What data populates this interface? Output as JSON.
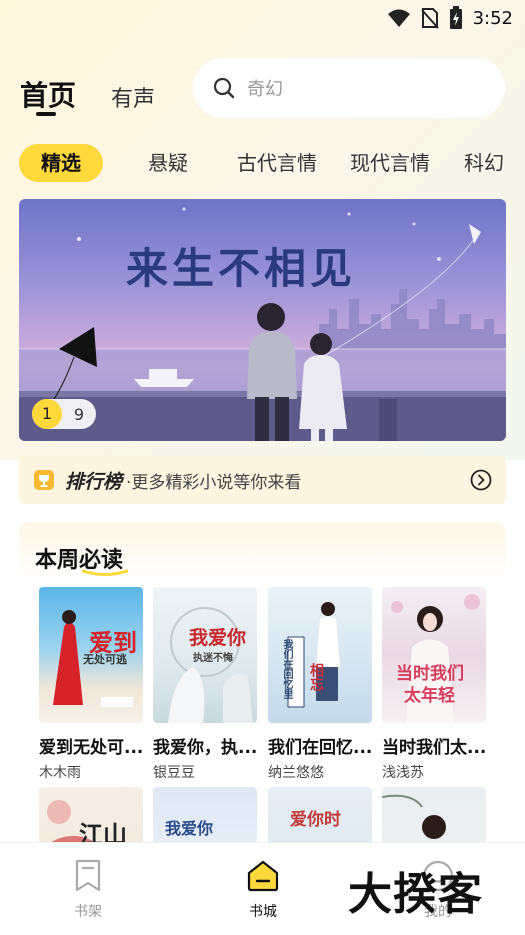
{
  "status_bar": {
    "time": "3:52"
  },
  "header": {
    "tabs": [
      {
        "label": "首页"
      },
      {
        "label": "有声"
      }
    ],
    "search": {
      "placeholder": "奇幻"
    }
  },
  "categories": [
    {
      "label": "精选"
    },
    {
      "label": "悬疑"
    },
    {
      "label": "古代言情"
    },
    {
      "label": "现代言情"
    },
    {
      "label": "科幻"
    }
  ],
  "banner": {
    "title": "来生不相见",
    "pager": {
      "current": "1",
      "total": "9"
    }
  },
  "ranking": {
    "title": "排行榜",
    "subtitle": "·更多精彩小说等你来看"
  },
  "weekly": {
    "title": "本周必读",
    "books": [
      {
        "title": "爱到无处可...",
        "author": "木木雨",
        "cover_text": "爱到",
        "cover_sub": "无处可逃"
      },
      {
        "title": "我爱你，执...",
        "author": "银豆豆",
        "cover_text": "我爱你",
        "cover_sub": "执迷不悔"
      },
      {
        "title": "我们在回忆...",
        "author": "纳兰悠悠",
        "cover_text": "相忘",
        "cover_sub": "我们在回忆里"
      },
      {
        "title": "当时我们太...",
        "author": "浅浅苏",
        "cover_text": "当时我们",
        "cover_sub": "太年轻"
      }
    ],
    "second_row": [
      {
        "cover_text": "江山"
      },
      {
        "cover_text": "我爱你"
      },
      {
        "cover_text": "爱你时"
      },
      {
        "cover_text": ""
      }
    ]
  },
  "bottom_nav": {
    "items": [
      {
        "label": "书架",
        "icon": "bookmark-icon"
      },
      {
        "label": "书城",
        "icon": "bookstore-icon"
      },
      {
        "label": "我的",
        "icon": "profile-icon"
      }
    ]
  },
  "watermark": "大揆客",
  "colors": {
    "accent": "#ffd83b",
    "banner_title": "#2a3a7c"
  }
}
